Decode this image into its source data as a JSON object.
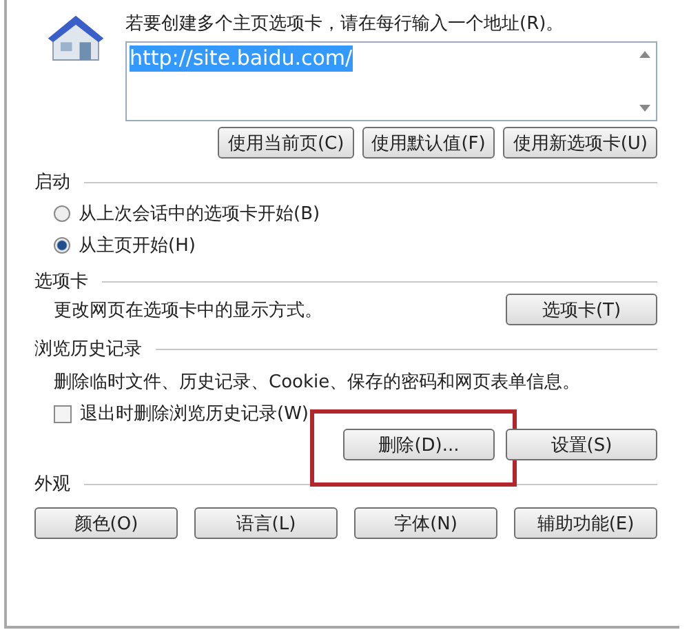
{
  "home_page": {
    "instruction": "若要创建多个主页选项卡，请在每行输入一个地址(R)。",
    "url_field": {
      "value": "http://site.baidu.com/",
      "selected": true
    },
    "buttons": [
      {
        "label": "使用当前页(C)"
      },
      {
        "label": "使用默认值(F)"
      },
      {
        "label": "使用新选项卡(U)"
      }
    ]
  },
  "startup": {
    "heading": "启动",
    "options": [
      {
        "label": "从上次会话中的选项卡开始(B)",
        "selected": false
      },
      {
        "label": "从主页开始(H)",
        "selected": true
      }
    ]
  },
  "tabs_section": {
    "heading": "选项卡",
    "description": "更改网页在选项卡中的显示方式。",
    "button": "选项卡(T)"
  },
  "history": {
    "heading": "浏览历史记录",
    "description": "删除临时文件、历史记录、Cookie、保存的密码和网页表单信息。",
    "checkbox": {
      "label": "退出时删除浏览历史记录(W)",
      "checked": false
    },
    "buttons": [
      {
        "label": "删除(D)...",
        "highlighted": true
      },
      {
        "label": "设置(S)",
        "highlighted": false
      }
    ]
  },
  "appearance": {
    "heading": "外观",
    "buttons": [
      {
        "label": "颜色(O)"
      },
      {
        "label": "语言(L)"
      },
      {
        "label": "字体(N)"
      },
      {
        "label": "辅助功能(E)"
      }
    ]
  }
}
